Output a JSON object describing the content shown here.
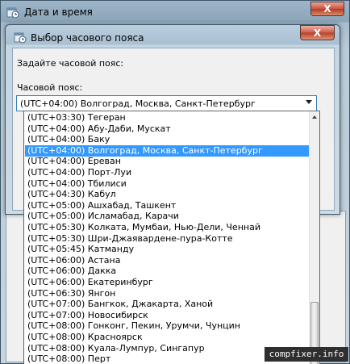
{
  "outer_window": {
    "title": "Дата и время",
    "close_label": "X"
  },
  "dialog": {
    "title": "Выбор часового пояса",
    "close_label": "X",
    "prompt": "Задайте часовой пояс:",
    "timezone_label": "Часовой пояс:",
    "selected_timezone": "(UTC+04:00) Волгоград, Москва, Санкт-Петербург"
  },
  "timezone_list": [
    "(UTC+03:30) Тегеран",
    "(UTC+04:00) Абу-Даби, Мускат",
    "(UTC+04:00) Баку",
    "(UTC+04:00) Волгоград, Москва, Санкт-Петербург",
    "(UTC+04:00) Ереван",
    "(UTC+04:00) Порт-Луи",
    "(UTC+04:00) Тбилиси",
    "(UTC+04:30) Кабул",
    "(UTC+05:00) Ашхабад, Ташкент",
    "(UTC+05:00) Исламабад, Карачи",
    "(UTC+05:30) Колката, Мумбаи, Нью-Дели, Ченнай",
    "(UTC+05:30) Шри-Джаявардене-пура-Котте",
    "(UTC+05:45) Катманду",
    "(UTC+06:00) Астана",
    "(UTC+06:00) Дакка",
    "(UTC+06:00) Екатеринбург",
    "(UTC+06:30) Янгон",
    "(UTC+07:00) Бангкок, Джакарта, Ханой",
    "(UTC+07:00) Новосибирск",
    "(UTC+08:00) Гонконг, Пекин, Урумчи, Чунцин",
    "(UTC+08:00) Красноярск",
    "(UTC+08:00) Куала-Лумпур, Сингапур",
    "(UTC+08:00) Перт"
  ],
  "selected_index": 3,
  "watermark": "compfixer.info"
}
